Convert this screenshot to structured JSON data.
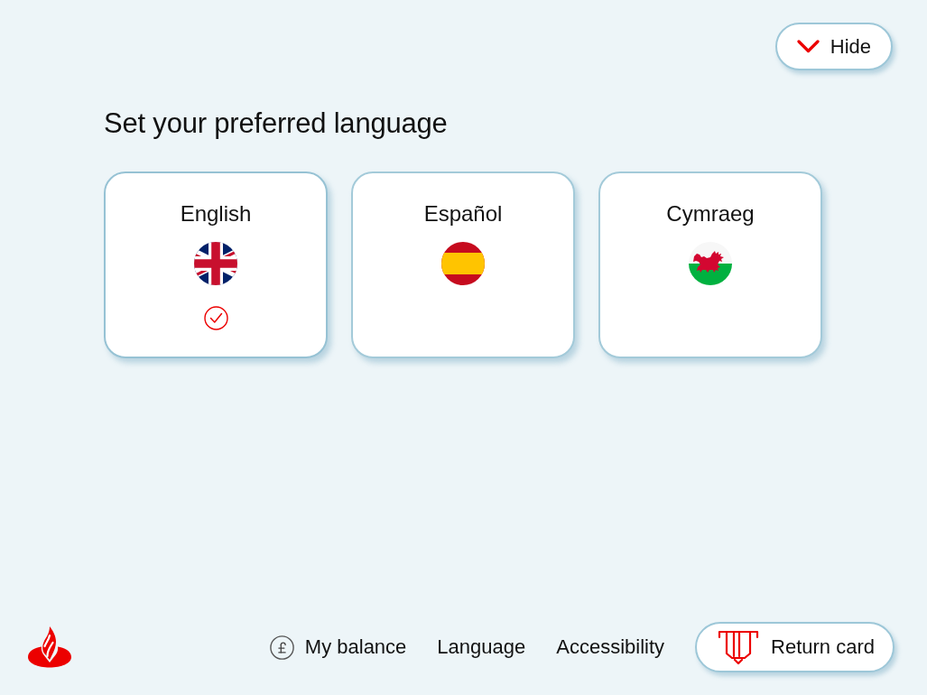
{
  "hide_button": {
    "label": "Hide"
  },
  "heading": "Set your preferred language",
  "languages": [
    {
      "label": "English",
      "kind": "uk",
      "selected": true
    },
    {
      "label": "Español",
      "kind": "spain",
      "selected": false
    },
    {
      "label": "Cymraeg",
      "kind": "wales",
      "selected": false
    }
  ],
  "footer": {
    "links": [
      {
        "label": "My balance",
        "kind": "balance"
      },
      {
        "label": "Language",
        "kind": "plain"
      },
      {
        "label": "Accessibility",
        "kind": "plain"
      }
    ],
    "return_card": {
      "label": "Return card"
    }
  }
}
